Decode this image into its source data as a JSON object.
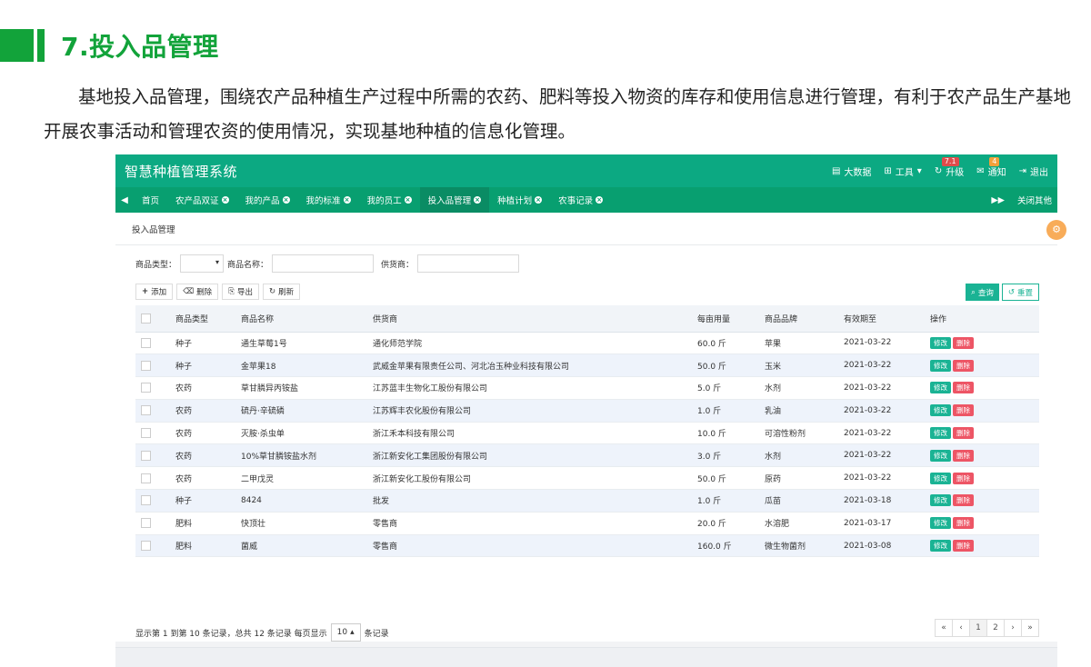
{
  "heading": {
    "title": "7.投入品管理"
  },
  "intro": "基地投入品管理，围绕农产品种植生产过程中所需的农药、肥料等投入物资的库存和使用信息进行管理，有利于农产品生产基地开展农事活动和管理农资的使用情况，实现基地种植的信息化管理。",
  "app": {
    "brand": "智慧种植管理系统",
    "top_actions": {
      "bigdata": "大数据",
      "tools": "工具",
      "upgrade": "升级",
      "upgrade_badge": "7.1",
      "notice": "通知",
      "notice_badge": "4",
      "logout": "退出"
    },
    "tabs": [
      "首页",
      "农产品双证",
      "我的产品",
      "我的标准",
      "我的员工",
      "投入品管理",
      "种植计划",
      "农事记录"
    ],
    "close_others": "关闭其他",
    "panel_title": "投入品管理",
    "filters": {
      "type_label": "商品类型：",
      "name_label": "商品名称：",
      "supplier_label": "供货商："
    },
    "toolbar": {
      "add": "添加",
      "delete": "删除",
      "export": "导出",
      "refresh": "刷新",
      "query": "查询",
      "reset": "重置"
    },
    "columns": [
      "商品类型",
      "商品名称",
      "供货商",
      "每亩用量",
      "商品品牌",
      "有效期至",
      "操作"
    ],
    "rows": [
      [
        "种子",
        "通生草莓1号",
        "通化师范学院",
        "60.0 斤",
        "苹果",
        "2021-03-22"
      ],
      [
        "种子",
        "金苹果18",
        "武威金苹果有限责任公司、河北冶玉种业科技有限公司",
        "50.0 斤",
        "玉米",
        "2021-03-22"
      ],
      [
        "农药",
        "草甘膦异丙铵盐",
        "江苏蓝丰生物化工股份有限公司",
        "5.0 斤",
        "水剂",
        "2021-03-22"
      ],
      [
        "农药",
        "硫丹·辛硫磷",
        "江苏辉丰农化股份有限公司",
        "1.0 斤",
        "乳油",
        "2021-03-22"
      ],
      [
        "农药",
        "灭胺·杀虫单",
        "浙江禾本科技有限公司",
        "10.0 斤",
        "可溶性粉剂",
        "2021-03-22"
      ],
      [
        "农药",
        "10%草甘膦铵盐水剂",
        "浙江新安化工集团股份有限公司",
        "3.0 斤",
        "水剂",
        "2021-03-22"
      ],
      [
        "农药",
        "二甲戊灵",
        "浙江新安化工股份有限公司",
        "50.0 斤",
        "原药",
        "2021-03-22"
      ],
      [
        "种子",
        "8424",
        "批发",
        "1.0 斤",
        "瓜苗",
        "2021-03-18"
      ],
      [
        "肥料",
        "快顶壮",
        "零售商",
        "20.0 斤",
        "水溶肥",
        "2021-03-17"
      ],
      [
        "肥料",
        "菌威",
        "零售商",
        "160.0 斤",
        "微生物菌剂",
        "2021-03-08"
      ]
    ],
    "row_ops": {
      "edit": "修改",
      "delete": "删除"
    },
    "footer": {
      "summary": "显示第 1 到第 10 条记录，总共 12 条记录 每页显示",
      "page_size": "10",
      "suffix": "条记录"
    },
    "pager": [
      "«",
      "‹",
      "1",
      "2",
      "›",
      "»"
    ]
  },
  "colors": {
    "accent": "#12a33a",
    "topbar": "#0ca982",
    "edit": "#1ab394",
    "delete": "#ed5565"
  }
}
